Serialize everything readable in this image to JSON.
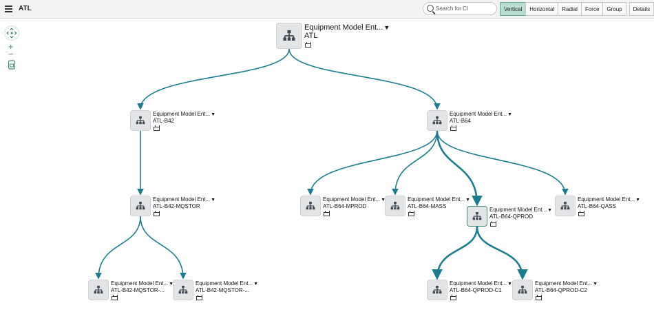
{
  "header": {
    "title": "ATL",
    "search_placeholder": "Search for CI",
    "layout_buttons": [
      "Vertical",
      "Horizontal",
      "Radial",
      "Force",
      "Group"
    ],
    "active_layout": "Vertical",
    "details_label": "Details"
  },
  "zoom": {
    "plus": "+",
    "minus": "−"
  },
  "colors": {
    "edge": "#1b7d8f",
    "active_button": "#b9ddd1",
    "node_bg": "#e3e4e6",
    "icon": "#3f4a55"
  },
  "nodes": [
    {
      "id": "atl",
      "type": "Equipment Model Ent...",
      "name": "ATL"
    },
    {
      "id": "b42",
      "type": "Equipment Model Ent...",
      "name": "ATL-B42"
    },
    {
      "id": "b64",
      "type": "Equipment Model Ent...",
      "name": "ATL-B64"
    },
    {
      "id": "b42-mqstor",
      "type": "Equipment Model Ent...",
      "name": "ATL-B42-MQSTOR"
    },
    {
      "id": "b64-mprod",
      "type": "Equipment Model Ent...",
      "name": "ATL-B64-MPROD"
    },
    {
      "id": "b64-mass",
      "type": "Equipment Model Ent...",
      "name": "ATL-B64-MASS"
    },
    {
      "id": "b64-qprod",
      "type": "Equipment Model Ent...",
      "name": "ATL-B64-QPROD"
    },
    {
      "id": "b64-qass",
      "type": "Equipment Model Ent...",
      "name": "ATL-B64-QASS"
    },
    {
      "id": "b42-mqstor-1",
      "type": "Equipment Model Ent...",
      "name": "ATL-B42-MQSTOR-..."
    },
    {
      "id": "b42-mqstor-2",
      "type": "Equipment Model Ent...",
      "name": "ATL-B42-MQSTOR-..."
    },
    {
      "id": "b64-qprod-c1",
      "type": "Equipment Model Ent...",
      "name": "ATL-B64-QPROD-C1"
    },
    {
      "id": "b64-qprod-c2",
      "type": "Equipment Model Ent...",
      "name": "ATL-B64-QPROD-C2"
    }
  ],
  "edges": [
    {
      "from": "atl",
      "to": "b42"
    },
    {
      "from": "atl",
      "to": "b64"
    },
    {
      "from": "b42",
      "to": "b42-mqstor"
    },
    {
      "from": "b64",
      "to": "b64-mprod"
    },
    {
      "from": "b64",
      "to": "b64-mass"
    },
    {
      "from": "b64",
      "to": "b64-qprod",
      "emphasis": true
    },
    {
      "from": "b64",
      "to": "b64-qass"
    },
    {
      "from": "b42-mqstor",
      "to": "b42-mqstor-1"
    },
    {
      "from": "b42-mqstor",
      "to": "b42-mqstor-2"
    },
    {
      "from": "b64-qprod",
      "to": "b64-qprod-c1",
      "emphasis": true
    },
    {
      "from": "b64-qprod",
      "to": "b64-qprod-c2",
      "emphasis": true
    }
  ]
}
